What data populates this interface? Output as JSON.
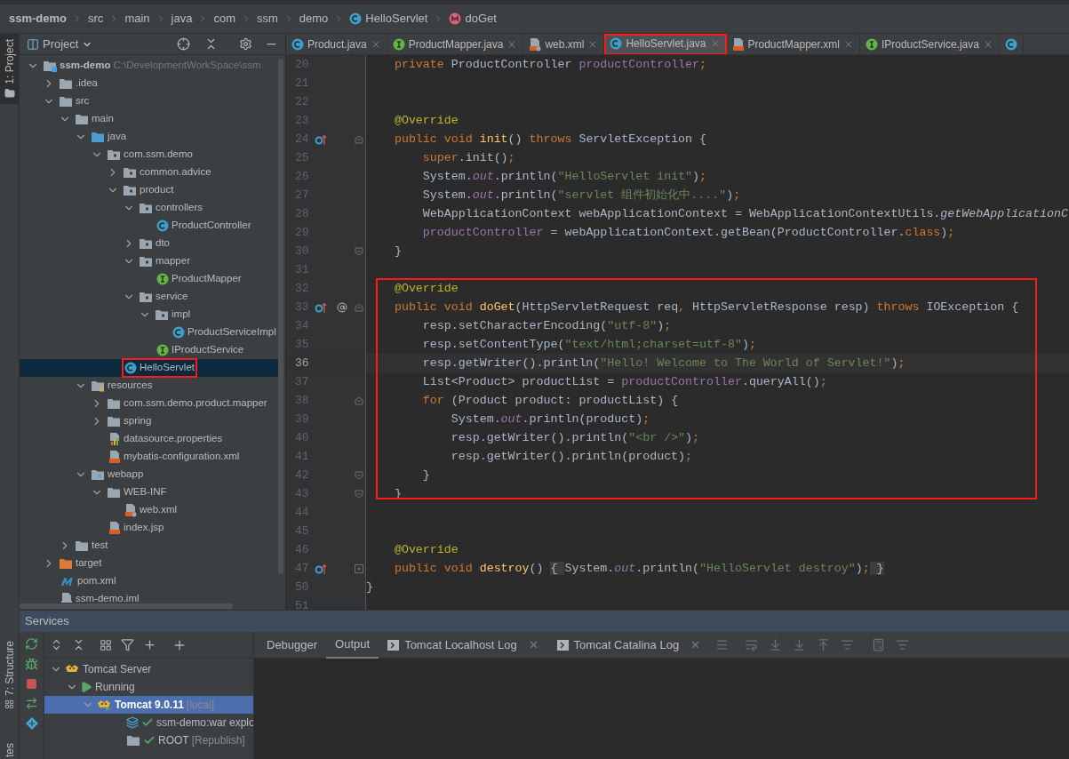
{
  "breadcrumb": [
    {
      "label": "ssm-demo",
      "kind": "project"
    },
    {
      "label": "src",
      "kind": "folder"
    },
    {
      "label": "main",
      "kind": "folder"
    },
    {
      "label": "java",
      "kind": "folder"
    },
    {
      "label": "com",
      "kind": "folder"
    },
    {
      "label": "ssm",
      "kind": "folder"
    },
    {
      "label": "demo",
      "kind": "folder"
    },
    {
      "label": "HelloServlet",
      "kind": "class"
    },
    {
      "label": "doGet",
      "kind": "method"
    }
  ],
  "side_tabs": [
    {
      "label": "1: Project",
      "selected": true,
      "kind": "project"
    },
    {
      "label": "7: Structure",
      "selected": false,
      "kind": "structure"
    },
    {
      "label": "tes",
      "selected": false,
      "kind": "favorites"
    }
  ],
  "project_panel": {
    "title": "Project",
    "tree": [
      {
        "label": "ssm-demo",
        "kind": "module",
        "hint": "C:\\DevelopmentWorkSpace\\ssm",
        "expanded": true,
        "selected": false,
        "children": [
          {
            "label": ".idea",
            "kind": "folder",
            "expanded": false,
            "selected": false
          },
          {
            "label": "src",
            "kind": "folder",
            "expanded": true,
            "selected": false,
            "children": [
              {
                "label": "main",
                "kind": "folder",
                "expanded": true,
                "selected": false,
                "children": [
                  {
                    "label": "java",
                    "kind": "source",
                    "expanded": true,
                    "selected": false,
                    "children": [
                      {
                        "label": "com.ssm.demo",
                        "kind": "package",
                        "expanded": true,
                        "selected": false,
                        "children": [
                          {
                            "label": "common.advice",
                            "kind": "package",
                            "expanded": false,
                            "selected": false
                          },
                          {
                            "label": "product",
                            "kind": "package",
                            "expanded": true,
                            "selected": false,
                            "children": [
                              {
                                "label": "controllers",
                                "kind": "package",
                                "expanded": true,
                                "selected": false,
                                "children": [
                                  {
                                    "label": "ProductController",
                                    "kind": "class",
                                    "selected": false
                                  }
                                ]
                              },
                              {
                                "label": "dto",
                                "kind": "package",
                                "expanded": false,
                                "selected": false
                              },
                              {
                                "label": "mapper",
                                "kind": "package",
                                "expanded": true,
                                "selected": false,
                                "children": [
                                  {
                                    "label": "ProductMapper",
                                    "kind": "interface",
                                    "selected": false
                                  }
                                ]
                              },
                              {
                                "label": "service",
                                "kind": "package",
                                "expanded": true,
                                "selected": false,
                                "children": [
                                  {
                                    "label": "impl",
                                    "kind": "package",
                                    "expanded": true,
                                    "selected": false,
                                    "children": [
                                      {
                                        "label": "ProductServiceImpl",
                                        "kind": "class",
                                        "selected": false
                                      }
                                    ]
                                  },
                                  {
                                    "label": "IProductService",
                                    "kind": "interface",
                                    "selected": false
                                  }
                                ]
                              }
                            ]
                          },
                          {
                            "label": "HelloServlet",
                            "kind": "class",
                            "selected": true,
                            "annotated": true
                          }
                        ]
                      }
                    ]
                  },
                  {
                    "label": "resources",
                    "kind": "resources",
                    "expanded": true,
                    "selected": false,
                    "children": [
                      {
                        "label": "com.ssm.demo.product.mapper",
                        "kind": "folder",
                        "expanded": false,
                        "selected": false
                      },
                      {
                        "label": "spring",
                        "kind": "folder",
                        "expanded": false,
                        "selected": false
                      },
                      {
                        "label": "datasource.properties",
                        "kind": "properties",
                        "selected": false
                      },
                      {
                        "label": "mybatis-configuration.xml",
                        "kind": "xml",
                        "selected": false
                      }
                    ]
                  },
                  {
                    "label": "webapp",
                    "kind": "webapp",
                    "expanded": true,
                    "selected": false,
                    "children": [
                      {
                        "label": "WEB-INF",
                        "kind": "folder",
                        "expanded": true,
                        "selected": false,
                        "children": [
                          {
                            "label": "web.xml",
                            "kind": "webxml",
                            "selected": false
                          }
                        ]
                      },
                      {
                        "label": "index.jsp",
                        "kind": "jsp",
                        "selected": false
                      }
                    ]
                  }
                ]
              },
              {
                "label": "test",
                "kind": "folder",
                "expanded": false,
                "selected": false
              }
            ]
          },
          {
            "label": "target",
            "kind": "excluded",
            "expanded": false,
            "selected": false
          },
          {
            "label": "pom.xml",
            "kind": "maven",
            "selected": false
          },
          {
            "label": "ssm-demo.iml",
            "kind": "iml",
            "selected": false
          }
        ]
      }
    ]
  },
  "editor_tabs": [
    {
      "label": "Product.java",
      "kind": "class",
      "selected": false
    },
    {
      "label": "ProductMapper.java",
      "kind": "interface",
      "selected": false
    },
    {
      "label": "web.xml",
      "kind": "webxml",
      "selected": false
    },
    {
      "label": "HelloServlet.java",
      "kind": "class",
      "selected": true,
      "annotated": true
    },
    {
      "label": "ProductMapper.xml",
      "kind": "xml",
      "selected": false
    },
    {
      "label": "IProductService.java",
      "kind": "interface",
      "selected": false
    },
    {
      "kind": "class",
      "selected": false
    }
  ],
  "code": {
    "sections": [
      {
        "boxed": false,
        "lines": [
          {
            "number": "20",
            "current": false,
            "tokens": [
              {
                "kind": "kw",
                "text": "    private "
              },
              {
                "kind": "plain",
                "text": "ProductController "
              },
              {
                "kind": "field",
                "text": "productController"
              },
              {
                "kind": "kw",
                "text": ";"
              }
            ]
          },
          {
            "number": "21",
            "current": false
          },
          {
            "number": "22",
            "current": false
          },
          {
            "number": "23",
            "current": false,
            "tokens": [
              {
                "kind": "ann",
                "text": "    @Override"
              }
            ]
          },
          {
            "number": "24",
            "current": false,
            "gutter": [
              {
                "kind": "override"
              },
              {
                "kind": "fold-open"
              }
            ],
            "tokens": [
              {
                "kind": "kw",
                "text": "    public void "
              },
              {
                "kind": "fn",
                "text": "init"
              },
              {
                "kind": "plain",
                "text": "() "
              },
              {
                "kind": "kw",
                "text": "throws "
              },
              {
                "kind": "plain",
                "text": "ServletException {"
              }
            ]
          },
          {
            "number": "25",
            "current": false,
            "tokens": [
              {
                "kind": "kw",
                "text": "        super"
              },
              {
                "kind": "plain",
                "text": ".init()"
              },
              {
                "kind": "kw",
                "text": ";"
              }
            ]
          },
          {
            "number": "26",
            "current": false,
            "tokens": [
              {
                "kind": "plain",
                "text": "        System."
              },
              {
                "kind": "static",
                "text": "out"
              },
              {
                "kind": "plain",
                "text": ".println("
              },
              {
                "kind": "str",
                "text": "\"HelloServlet init\""
              },
              {
                "kind": "plain",
                "text": ")"
              },
              {
                "kind": "kw",
                "text": ";"
              }
            ]
          },
          {
            "number": "27",
            "current": false,
            "tokens": [
              {
                "kind": "plain",
                "text": "        System."
              },
              {
                "kind": "static",
                "text": "out"
              },
              {
                "kind": "plain",
                "text": ".println("
              },
              {
                "kind": "str",
                "text": "\"servlet 组件初始化中....\""
              },
              {
                "kind": "plain",
                "text": ")"
              },
              {
                "kind": "kw",
                "text": ";"
              }
            ]
          },
          {
            "number": "28",
            "current": false,
            "tokens": [
              {
                "kind": "plain",
                "text": "        WebApplicationContext webApplicationContext = WebApplicationContextUtils."
              },
              {
                "kind": "italic",
                "text": "getWebApplicationC"
              }
            ]
          },
          {
            "number": "29",
            "current": false,
            "tokens": [
              {
                "kind": "field",
                "text": "        productController"
              },
              {
                "kind": "plain",
                "text": " = webApplicationContext.getBean(ProductController."
              },
              {
                "kind": "kw",
                "text": "class"
              },
              {
                "kind": "plain",
                "text": ")"
              },
              {
                "kind": "kw",
                "text": ";"
              }
            ]
          },
          {
            "number": "30",
            "current": false,
            "gutter": [
              {
                "kind": "fold-close"
              }
            ],
            "tokens": [
              {
                "kind": "plain",
                "text": "    }"
              }
            ]
          },
          {
            "number": "31",
            "current": false
          }
        ]
      },
      {
        "boxed": true,
        "lines": [
          {
            "number": "32",
            "current": false,
            "tokens": [
              {
                "kind": "ann",
                "text": "    @Override"
              }
            ]
          },
          {
            "number": "33",
            "current": false,
            "gutter": [
              {
                "kind": "override"
              },
              {
                "kind": "web"
              },
              {
                "kind": "fold-open"
              }
            ],
            "tokens": [
              {
                "kind": "kw",
                "text": "    public void "
              },
              {
                "kind": "fn",
                "text": "doGet"
              },
              {
                "kind": "plain",
                "text": "(HttpServletRequest req"
              },
              {
                "kind": "kw",
                "text": ", "
              },
              {
                "kind": "plain",
                "text": "HttpServletResponse resp) "
              },
              {
                "kind": "kw",
                "text": "throws "
              },
              {
                "kind": "plain",
                "text": "IOException {"
              }
            ]
          },
          {
            "number": "34",
            "current": false,
            "tokens": [
              {
                "kind": "plain",
                "text": "        resp.setCharacterEncoding("
              },
              {
                "kind": "str",
                "text": "\"utf-8\""
              },
              {
                "kind": "plain",
                "text": ")"
              },
              {
                "kind": "kw",
                "text": ";"
              }
            ]
          },
          {
            "number": "35",
            "current": false,
            "tokens": [
              {
                "kind": "plain",
                "text": "        resp.setContentType("
              },
              {
                "kind": "str",
                "text": "\"text/html;charset=utf-8\""
              },
              {
                "kind": "plain",
                "text": ")"
              },
              {
                "kind": "kw",
                "text": ";"
              }
            ]
          },
          {
            "number": "36",
            "current": true,
            "tokens": [
              {
                "kind": "plain",
                "text": "        resp.getWriter().println("
              },
              {
                "kind": "str",
                "text": "\"Hello! Welcome to The World of Servlet!\""
              },
              {
                "kind": "plain",
                "text": ")"
              },
              {
                "kind": "kw",
                "text": ";"
              }
            ]
          },
          {
            "number": "37",
            "current": false,
            "tokens": [
              {
                "kind": "plain",
                "text": "        List<Product> productList = "
              },
              {
                "kind": "field",
                "text": "productController"
              },
              {
                "kind": "plain",
                "text": ".queryAll()"
              },
              {
                "kind": "kw",
                "text": ";"
              }
            ]
          },
          {
            "number": "38",
            "current": false,
            "gutter": [
              {
                "kind": "fold-open"
              }
            ],
            "tokens": [
              {
                "kind": "kw",
                "text": "        for "
              },
              {
                "kind": "plain",
                "text": "(Product product: productList) {"
              }
            ]
          },
          {
            "number": "39",
            "current": false,
            "tokens": [
              {
                "kind": "plain",
                "text": "            System."
              },
              {
                "kind": "static",
                "text": "out"
              },
              {
                "kind": "plain",
                "text": ".println(product)"
              },
              {
                "kind": "kw",
                "text": ";"
              }
            ]
          },
          {
            "number": "40",
            "current": false,
            "tokens": [
              {
                "kind": "plain",
                "text": "            resp.getWriter().println("
              },
              {
                "kind": "str",
                "text": "\"<br />\""
              },
              {
                "kind": "plain",
                "text": ")"
              },
              {
                "kind": "kw",
                "text": ";"
              }
            ]
          },
          {
            "number": "41",
            "current": false,
            "tokens": [
              {
                "kind": "plain",
                "text": "            resp.getWriter().println(product)"
              },
              {
                "kind": "kw",
                "text": ";"
              }
            ]
          },
          {
            "number": "42",
            "current": false,
            "gutter": [
              {
                "kind": "fold-close"
              }
            ],
            "tokens": [
              {
                "kind": "plain",
                "text": "        }"
              }
            ]
          },
          {
            "number": "43",
            "current": false,
            "gutter": [
              {
                "kind": "fold-close"
              }
            ],
            "tokens": [
              {
                "kind": "plain",
                "text": "    }"
              }
            ]
          }
        ]
      },
      {
        "boxed": false,
        "lines": [
          {
            "number": "44",
            "current": false
          },
          {
            "number": "45",
            "current": false
          },
          {
            "number": "46",
            "current": false,
            "tokens": [
              {
                "kind": "ann",
                "text": "    @Override"
              }
            ]
          },
          {
            "number": "47",
            "current": false,
            "gutter": [
              {
                "kind": "override"
              },
              {
                "kind": "fold-collapsed"
              }
            ],
            "tokens": [
              {
                "kind": "kw",
                "text": "    public void "
              },
              {
                "kind": "fn",
                "text": "destroy"
              },
              {
                "kind": "plain",
                "text": "() "
              },
              {
                "kind": "fold",
                "text": "{ "
              },
              {
                "kind": "plain",
                "text": "System."
              },
              {
                "kind": "static",
                "text": "out"
              },
              {
                "kind": "plain",
                "text": ".println("
              },
              {
                "kind": "str",
                "text": "\"HelloServlet destroy\""
              },
              {
                "kind": "plain",
                "text": ")"
              },
              {
                "kind": "kw",
                "text": ";"
              },
              {
                "kind": "fold",
                "text": " }"
              }
            ]
          },
          {
            "number": "50",
            "current": false,
            "tokens": [
              {
                "kind": "plain",
                "text": "}"
              }
            ]
          },
          {
            "number": "51",
            "current": false
          }
        ]
      }
    ]
  },
  "services": {
    "title": "Services",
    "tree": [
      {
        "label": "Tomcat Server",
        "kind": "tomcat",
        "expanded": true,
        "selected": false,
        "children": [
          {
            "label": "Running",
            "kind": "running",
            "expanded": true,
            "selected": false,
            "children": [
              {
                "label": "Tomcat 9.0.11",
                "hint": "[local]",
                "kind": "tomcat-run",
                "expanded": true,
                "selected": true,
                "children": [
                  {
                    "label": "ssm-demo:war explo",
                    "kind": "artifact",
                    "deployed": true,
                    "selected": false
                  },
                  {
                    "label": "ROOT",
                    "hint": "[Republish]",
                    "kind": "folder",
                    "deployed": true,
                    "selected": false
                  }
                ]
              }
            ]
          }
        ]
      }
    ],
    "output_tabs": [
      {
        "label": "Debugger",
        "kind": "plain",
        "selected": false
      },
      {
        "label": "Output",
        "kind": "plain",
        "selected": true
      },
      {
        "label": "Tomcat Localhost Log",
        "kind": "console",
        "selected": false
      },
      {
        "label": "Tomcat Catalina Log",
        "kind": "console",
        "selected": false
      }
    ]
  }
}
